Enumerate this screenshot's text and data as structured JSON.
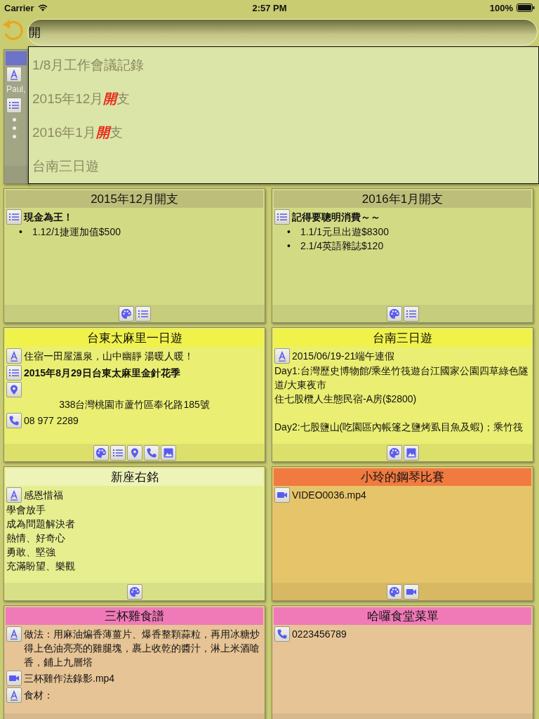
{
  "status_bar": {
    "carrier": "Carrier",
    "time": "2:57 PM",
    "battery": "100%"
  },
  "search": {
    "value": "開"
  },
  "covered_cards": [
    {
      "header": {
        "color": "#6d73c6"
      },
      "body": {
        "color": "#a3a685"
      },
      "dimmed": true,
      "items": [
        {
          "kind": "text"
        },
        {
          "kind": "line",
          "text": "Paul,"
        },
        {
          "kind": "list"
        },
        {
          "kind": "bullet"
        },
        {
          "kind": "bullet"
        },
        {
          "kind": "bullet"
        }
      ]
    }
  ],
  "cards": [
    {
      "title": "2015年12月開支",
      "header": {
        "color": "#bcbe7a"
      },
      "body": {
        "color": "#d3da84"
      },
      "dimmed": false,
      "items": [
        {
          "kind": "list",
          "title": "現金為王！",
          "bullets": [
            {
              "marker": "•",
              "text": "1.12/1捷運加值$500"
            }
          ]
        }
      ],
      "tools": [
        {
          "kind": "palette"
        },
        {
          "kind": "list"
        }
      ]
    },
    {
      "title": "2016年1月開支",
      "header": {
        "color": "#bcbe7a"
      },
      "body": {
        "color": "#d3da84"
      },
      "dimmed": false,
      "items": [
        {
          "kind": "list",
          "title": "記得要聰明消費～～",
          "bullets": [
            {
              "marker": "•",
              "text": "1.1/1元旦出遊$8300"
            },
            {
              "marker": "•",
              "text": "2.1/4英語雜誌$120"
            }
          ]
        }
      ],
      "tools": [
        {
          "kind": "palette"
        },
        {
          "kind": "list"
        }
      ]
    },
    {
      "title": "台東太麻里一日遊",
      "header": {
        "color": "#f0f24a"
      },
      "body": {
        "color": "#eaee72"
      },
      "dimmed": false,
      "items": [
        {
          "kind": "text",
          "text": "住宿一田屋溫泉，山中幽靜 湯暖人暖！"
        },
        {
          "kind": "list",
          "title": "2015年8月29日台東太麻里金針花季"
        },
        {
          "kind": "location",
          "text": "338台灣桃園市蘆竹區奉化路185號"
        },
        {
          "kind": "phone",
          "text": "08 977 2289"
        }
      ],
      "tools": [
        {
          "kind": "palette"
        },
        {
          "kind": "list"
        },
        {
          "kind": "location"
        },
        {
          "kind": "phone"
        },
        {
          "kind": "image"
        }
      ]
    },
    {
      "title": "台南三日遊",
      "header": {
        "color": "#f0f24a"
      },
      "body": {
        "color": "#eaee72"
      },
      "dimmed": false,
      "items": [
        {
          "kind": "text",
          "text": "2015/06/19-21端午連假"
        },
        {
          "kind": "line",
          "text": "Day1:台灣歷史博物館/乘坐竹筏遊台江國家公園四草綠色隧道/大東夜市"
        },
        {
          "kind": "line",
          "text": "住七股欖人生態民宿-A房($2800)"
        },
        {
          "kind": "gap"
        },
        {
          "kind": "line",
          "text": "Day2:七股鹽山(吃園區內帳篷之鹽烤虱目魚及蝦)；乘竹筏"
        }
      ],
      "tools": [
        {
          "kind": "palette"
        },
        {
          "kind": "image"
        }
      ]
    },
    {
      "title": "新座右銘",
      "header": {
        "color": "#eef3b8"
      },
      "body": {
        "color": "#e6ee90"
      },
      "dimmed": false,
      "items": [
        {
          "kind": "text",
          "text": "感恩惜福"
        },
        {
          "kind": "line",
          "text": "學會放手"
        },
        {
          "kind": "line",
          "text": "成為問題解決者"
        },
        {
          "kind": "line",
          "text": "熱情、好奇心"
        },
        {
          "kind": "line",
          "text": "勇敢、堅強"
        },
        {
          "kind": "line",
          "text": "充滿盼望、樂觀"
        }
      ],
      "tools": [
        {
          "kind": "palette"
        }
      ]
    },
    {
      "title": "小玲的鋼琴比賽",
      "header": {
        "color": "#f07a40"
      },
      "body": {
        "color": "#e6c46a"
      },
      "dimmed": false,
      "items": [
        {
          "kind": "video",
          "text": "VIDEO0036.mp4"
        }
      ],
      "tools": [
        {
          "kind": "palette"
        },
        {
          "kind": "video"
        }
      ]
    },
    {
      "title": "三杯雞食譜",
      "header": {
        "color": "#f07ab8"
      },
      "body": {
        "color": "#e6c496"
      },
      "dimmed": false,
      "items": [
        {
          "kind": "text",
          "text": "做法：用麻油煸香薄薑片、爆香整顆蒜粒，再用冰糖炒得上色油亮亮的雞腿塊，裹上收乾的醬汁，淋上米酒嗆香，鋪上九層塔"
        },
        {
          "kind": "video",
          "text": "三杯雞作法錄影.mp4"
        },
        {
          "kind": "text",
          "text": "食材："
        }
      ]
    },
    {
      "title": "哈囉食堂菜單",
      "header": {
        "color": "#f07ab8"
      },
      "body": {
        "color": "#e6c496"
      },
      "dimmed": false,
      "items": [
        {
          "kind": "phone",
          "text": "0223456789"
        }
      ]
    }
  ],
  "suggestions": [
    {
      "text": "1/8月工作會議記錄"
    },
    {
      "text": "2015年12月**開**支"
    },
    {
      "text": "2016年1月**開**支"
    },
    {
      "text": "台南三日遊"
    }
  ]
}
